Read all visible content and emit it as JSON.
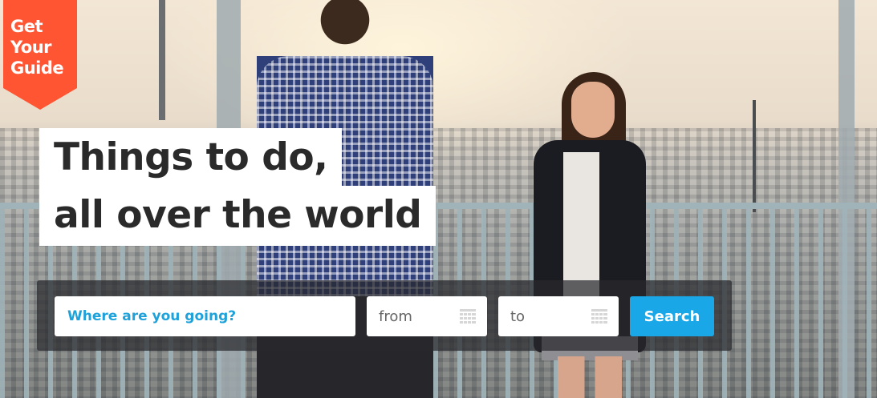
{
  "brand": {
    "logo_lines": [
      "Get",
      "Your",
      "Guide"
    ],
    "logo_color": "#ff5533"
  },
  "hero": {
    "headline_line1": "Things to do,",
    "headline_line2": "all over the world"
  },
  "search": {
    "destination_placeholder": "Where are you going?",
    "from_placeholder": "from",
    "to_placeholder": "to",
    "button_label": "Search",
    "button_color": "#1aa7e8",
    "placeholder_color": "#1fa1d9"
  },
  "icons": {
    "calendar": "calendar-icon"
  }
}
